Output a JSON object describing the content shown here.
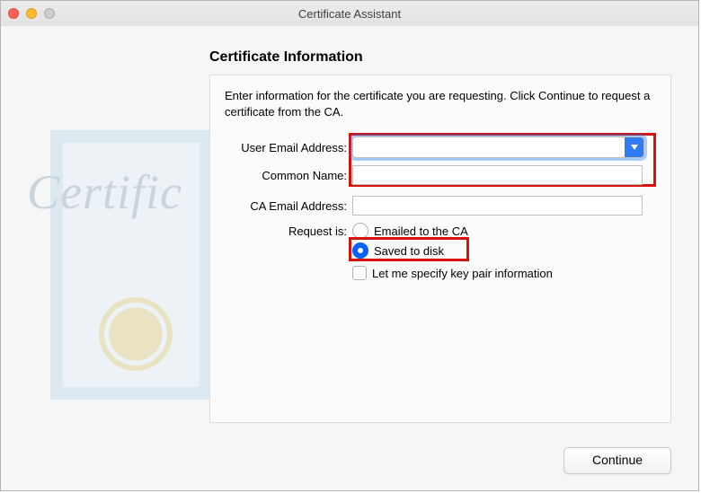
{
  "window": {
    "title": "Certificate Assistant"
  },
  "panel": {
    "heading": "Certificate Information",
    "intro": "Enter information for the certificate you are requesting. Click Continue to request a certificate from the CA."
  },
  "fields": {
    "user_email_label": "User Email Address:",
    "user_email_value": "",
    "common_name_label": "Common Name:",
    "common_name_value": "",
    "ca_email_label": "CA Email Address:",
    "ca_email_value": "",
    "request_label": "Request is:"
  },
  "request_options": {
    "emailed": "Emailed to the CA",
    "saved": "Saved to disk",
    "selected": "saved"
  },
  "keypair": {
    "label": "Let me specify key pair information",
    "checked": false
  },
  "buttons": {
    "continue": "Continue"
  },
  "art_text": "Certific"
}
